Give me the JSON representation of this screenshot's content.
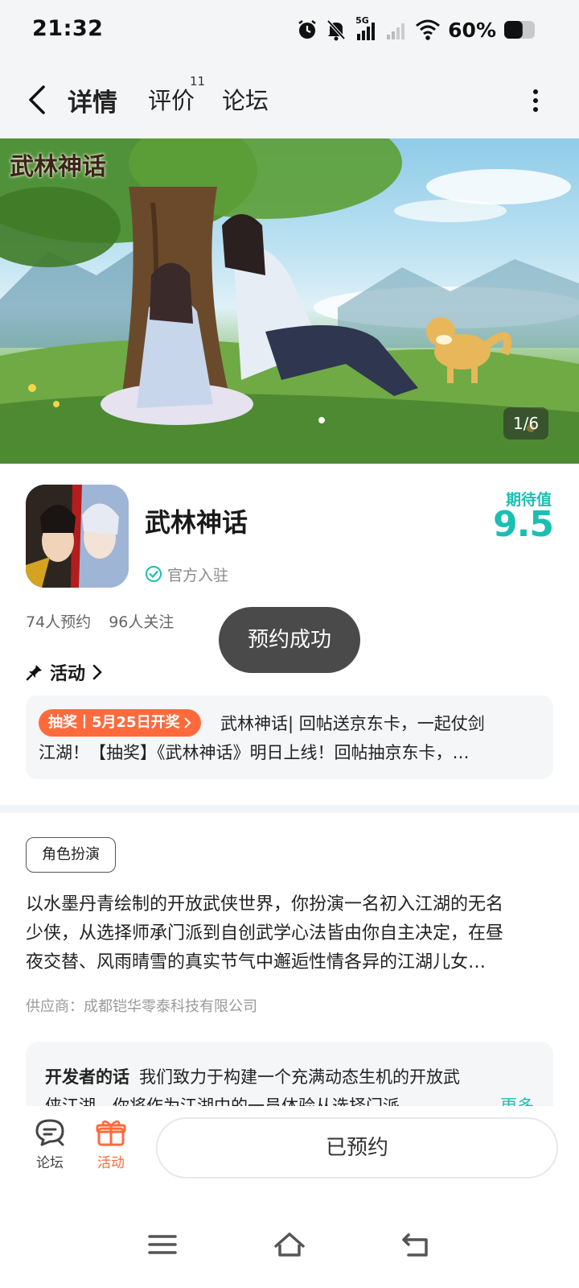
{
  "status_bar": {
    "time": "21:32",
    "network_label": "5G",
    "battery_percent": "60%",
    "battery_level": 0.6,
    "icons": [
      "alarm-icon",
      "mute-icon",
      "signal-5g-icon",
      "signal-weak-icon",
      "wifi-icon",
      "battery-icon"
    ]
  },
  "header": {
    "tabs": [
      {
        "label": "详情",
        "active": true
      },
      {
        "label": "评价",
        "badge": "11"
      },
      {
        "label": "论坛"
      }
    ],
    "icons": [
      "back-icon",
      "more-vertical-icon"
    ]
  },
  "banner": {
    "logo_text": "武林神话",
    "counter": "1/6"
  },
  "app": {
    "name": "武林神话",
    "official_label": "官方入驻",
    "expect_label": "期待值",
    "expect_value": "9.5",
    "reservations": "74人预约",
    "followers": "96人关注"
  },
  "toast": "预约成功",
  "activity": {
    "label": "活动",
    "tag": "抽奖丨5月25日开奖",
    "line1": "武林神话| 回帖送京东卡，一起仗剑",
    "line2": "江湖！【抽奖】《武林神话》明日上线！回帖抽京东卡，…"
  },
  "genre_tag": "角色扮演",
  "description": {
    "lines": [
      "以水墨丹青绘制的开放武侠世界，你扮演一名初入江湖的无名",
      "少侠，从选择师承门派到自创武学心法皆由你自主决定，在昼",
      "夜交替、风雨晴雪的真实节气中邂逅性情各异的江湖儿女…"
    ]
  },
  "supplier": "供应商：成都铠华零泰科技有限公司",
  "developer_note": {
    "title": "开发者的话",
    "line1": "我们致力于构建一个充满动态生机的开放武",
    "line2": "侠江湖，你将作为江湖中的一员体验从选择门派",
    "more": "更多"
  },
  "bottom_bar": {
    "forum_label": "论坛",
    "activity_label": "活动",
    "reserved_label": "已预约"
  },
  "colors": {
    "accent_teal": "#1bbfb2",
    "accent_orange": "#ff6a3d"
  }
}
